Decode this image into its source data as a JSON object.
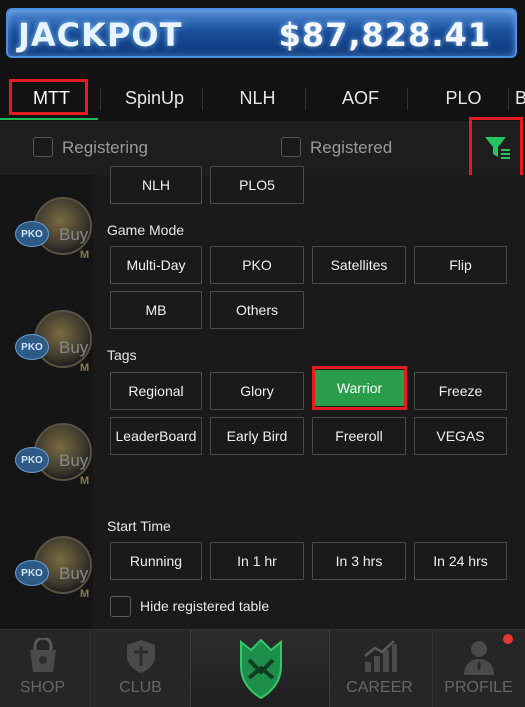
{
  "jackpot": {
    "label": "JACKPOT",
    "amount": "$87,828.41"
  },
  "tabs": [
    {
      "label": "MTT",
      "active": true
    },
    {
      "label": "SpinUp",
      "active": false
    },
    {
      "label": "NLH",
      "active": false
    },
    {
      "label": "AOF",
      "active": false
    },
    {
      "label": "PLO",
      "active": false
    },
    {
      "label": "B",
      "active": false
    }
  ],
  "filter_row": {
    "registering_label": "Registering",
    "registered_label": "Registered",
    "filter_icon": "filter-icon",
    "accent": "#1db954"
  },
  "list": {
    "buy_label": "Buy",
    "pko_badge": "PKO",
    "m_badge": "M"
  },
  "panel": {
    "game_type_options": [
      "NLH",
      "PLO5"
    ],
    "game_mode": {
      "header": "Game Mode",
      "options": [
        "Multi-Day",
        "PKO",
        "Satellites",
        "Flip",
        "MB",
        "Others"
      ]
    },
    "tags": {
      "header": "Tags",
      "options": [
        "Regional",
        "Glory",
        "Warrior",
        "Freeze",
        "LeaderBoard",
        "Early Bird",
        "Freeroll",
        "VEGAS"
      ],
      "selected": "Warrior"
    },
    "start_time": {
      "header": "Start Time",
      "options": [
        "Running",
        "In 1 hr",
        "In 3 hrs",
        "In 24 hrs"
      ]
    },
    "hide_registered_label": "Hide registered table",
    "selected_color": "#2a9d4b"
  },
  "bottom_nav": {
    "shop": "SHOP",
    "club": "CLUB",
    "career": "CAREER",
    "profile": "PROFILE",
    "center_icon": "crown-shield-logo-icon"
  }
}
